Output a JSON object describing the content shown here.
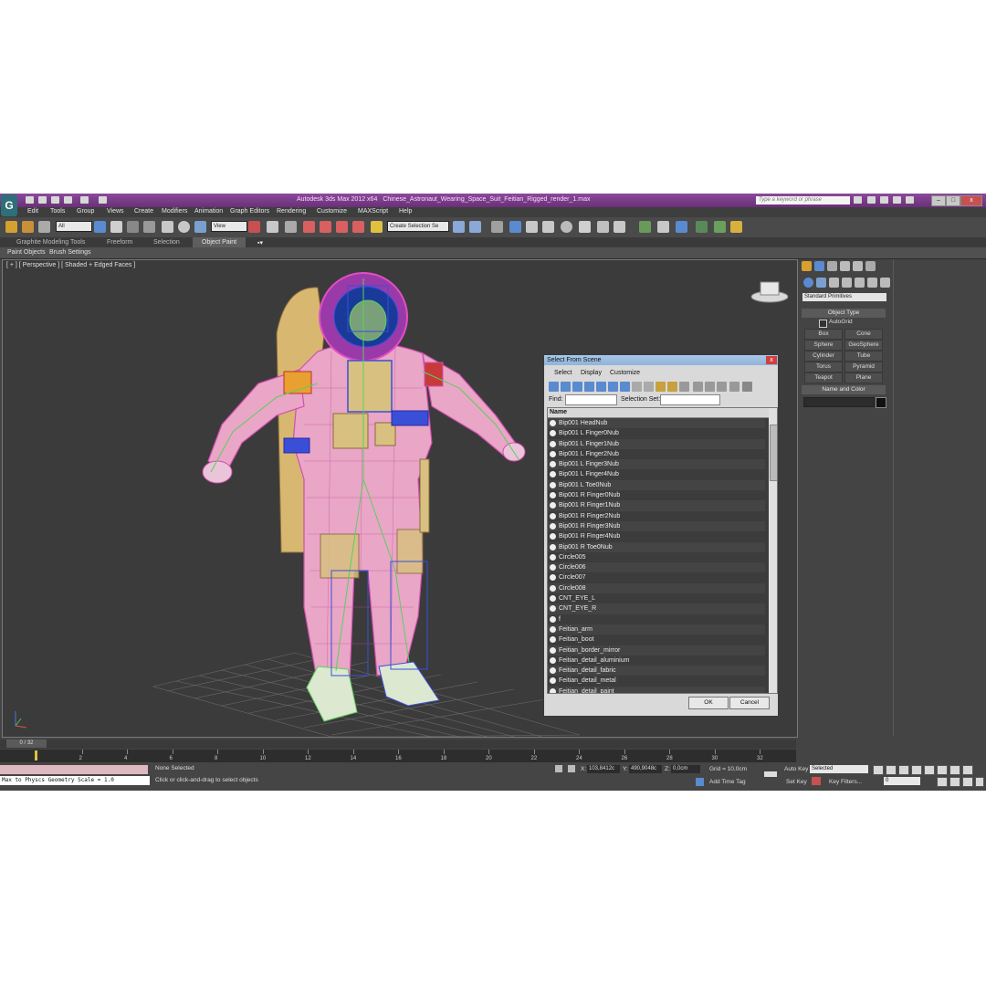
{
  "titlebar": {
    "app_title": "Autodesk 3ds Max  2012 x64",
    "file_name": "Chinese_Astronaut_Wearing_Space_Suit_Feitian_Rigged_render_1.max",
    "search_placeholder": "Type a keyword or phrase"
  },
  "menu": [
    "Edit",
    "Tools",
    "Group",
    "Views",
    "Create",
    "Modifiers",
    "Animation",
    "Graph Editors",
    "Rendering",
    "Customize",
    "MAXScript",
    "Help"
  ],
  "toolbar": {
    "filter_value": "All",
    "ref_coord_value": "View",
    "named_selection_value": "Create Selection Se"
  },
  "ribbon": {
    "tabs": [
      "Graphite Modeling Tools",
      "Freeform",
      "Selection",
      "Object Paint"
    ],
    "subtabs": [
      "Paint Objects",
      "Brush Settings"
    ]
  },
  "viewport": {
    "label": "[ + ] [ Perspective ] [ Shaded + Edged Faces ]"
  },
  "command_panel": {
    "category_value": "Standard Primitives",
    "object_type_title": "Object Type",
    "autogrid_label": "AutoGrid",
    "buttons": [
      "Box",
      "Cone",
      "Sphere",
      "GeoSphere",
      "Cylinder",
      "Tube",
      "Torus",
      "Pyramid",
      "Teapot",
      "Plane"
    ],
    "name_color_title": "Name and Color"
  },
  "dialog": {
    "title": "Select From Scene",
    "close": "x",
    "menu": [
      "Select",
      "Display",
      "Customize"
    ],
    "find_label": "Find:",
    "selection_set_label": "Selection Set:",
    "column_name": "Name",
    "rows": [
      "Bip001 HeadNub",
      "Bip001 L Finger0Nub",
      "Bip001 L Finger1Nub",
      "Bip001 L Finger2Nub",
      "Bip001 L Finger3Nub",
      "Bip001 L Finger4Nub",
      "Bip001 L Toe0Nub",
      "Bip001 R Finger0Nub",
      "Bip001 R Finger1Nub",
      "Bip001 R Finger2Nub",
      "Bip001 R Finger3Nub",
      "Bip001 R Finger4Nub",
      "Bip001 R Toe0Nub",
      "Circle005",
      "Circle006",
      "Circle007",
      "Circle008",
      "CNT_EYE_L",
      "CNT_EYE_R",
      "f",
      "Feitian_arm",
      "Feitian_boot",
      "Feitian_border_mirror",
      "Feitian_detail_aluminium",
      "Feitian_detail_fabric",
      "Feitian_detail_metal",
      "Feitian_detail_paint"
    ],
    "ok": "OK",
    "cancel": "Cancel"
  },
  "timeline": {
    "frame_indicator": "0 / 32",
    "ticks": [
      "0",
      "2",
      "4",
      "6",
      "8",
      "10",
      "12",
      "14",
      "16",
      "18",
      "20",
      "22",
      "24",
      "26",
      "28",
      "30",
      "32"
    ]
  },
  "status": {
    "maxscript_line": "Max to Physcs Geometry Scale = 1.0",
    "selection": "None Selected",
    "prompt": "Click or click-and-drag to select objects",
    "x_label": "X:",
    "x_value": "103,8412c",
    "y_label": "Y:",
    "y_value": "490,9048c",
    "z_label": "Z:",
    "z_value": "0,0cm",
    "grid": "Grid = 10,0cm",
    "add_time_tag": "Add Time Tag",
    "auto_key": "Auto Key",
    "auto_key_value": "Selected",
    "set_key": "Set Key",
    "key_filters": "Key Filters...",
    "frame_value": "0"
  },
  "colors": {
    "titlebar": "#7a3a88",
    "viewport_bg": "#3b3b3b",
    "wire_pink": "#e24fc4",
    "wire_green": "#5ccf5c",
    "wire_blue": "#3a4fd8"
  }
}
